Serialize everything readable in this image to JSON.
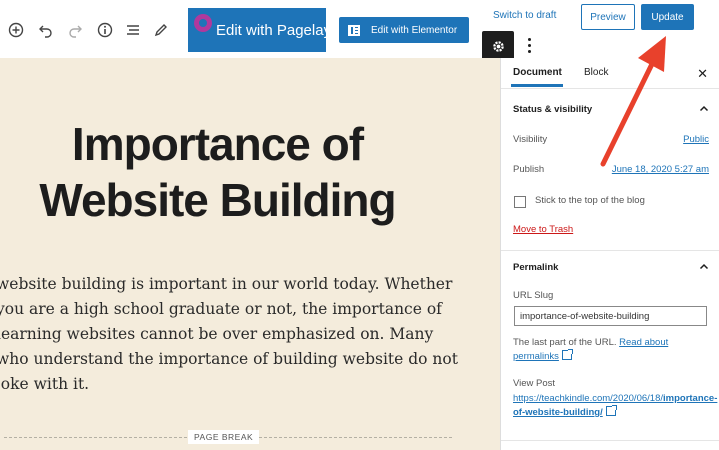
{
  "toolbar": {
    "pagelayer_label": "Edit with Pagelayer",
    "elementor_label": "Edit with Elementor",
    "switch_to_draft": "Switch to draft",
    "preview": "Preview",
    "update": "Update"
  },
  "post": {
    "title": "Importance of Website Building",
    "body": "website building is important in our world today. Whether you are a high school graduate or not, the importance of learning websites cannot be over emphasized on. Many who understand the importance of building website do not joke with it.",
    "page_break": "PAGE BREAK"
  },
  "sidebar": {
    "tabs": [
      "Document",
      "Block"
    ],
    "status": {
      "heading": "Status & visibility",
      "visibility_label": "Visibility",
      "visibility_value": "Public",
      "publish_label": "Publish",
      "publish_value": "June 18, 2020 5:27 am",
      "sticky_label": "Stick to the top of the blog",
      "trash": "Move to Trash"
    },
    "permalink": {
      "heading": "Permalink",
      "slug_label": "URL Slug",
      "slug_value": "importance-of-website-building",
      "help_text": "The last part of the URL.",
      "help_link": "Read about permalinks",
      "view_label": "View Post",
      "view_url_prefix": "https://teachkindle.com/2020/06/18/",
      "view_url_bold": "importance-of-website-building/"
    }
  },
  "colors": {
    "accent": "#1e74b8",
    "canvas": "#f4ecdc",
    "annotation_arrow": "#e8412c",
    "danger": "#cc1818"
  }
}
